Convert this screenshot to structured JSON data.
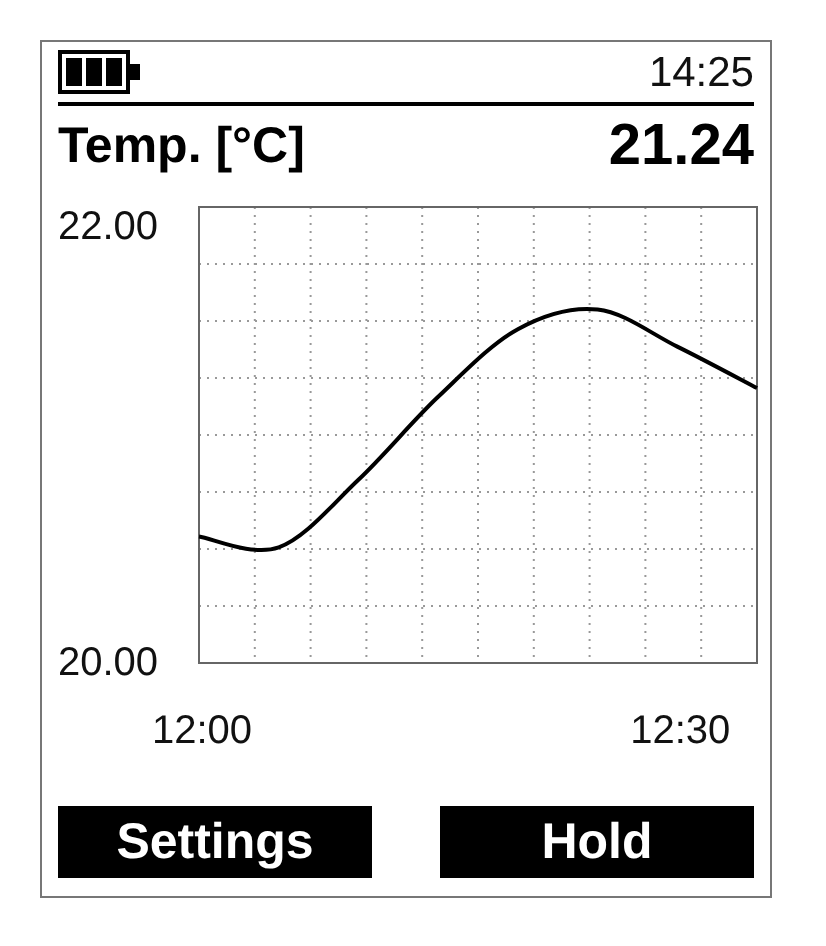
{
  "status_bar": {
    "time": "14:25"
  },
  "header": {
    "label": "Temp. [°C]",
    "value": "21.24"
  },
  "chart_data": {
    "type": "line",
    "categories": [
      "12:00",
      null,
      null,
      null,
      null,
      null,
      "12:30",
      null
    ],
    "series": [
      {
        "color": "#000000",
        "values": [
          20.58,
          20.53,
          20.84,
          21.22,
          21.53,
          21.62,
          21.45,
          21.26
        ]
      }
    ],
    "ylim": [
      20,
      22.09
    ],
    "yticks": [
      {
        "value": 20,
        "label": "20.00"
      },
      {
        "value": 22,
        "label": "22.00"
      }
    ]
  },
  "buttons": [
    "Settings",
    "Hold"
  ]
}
